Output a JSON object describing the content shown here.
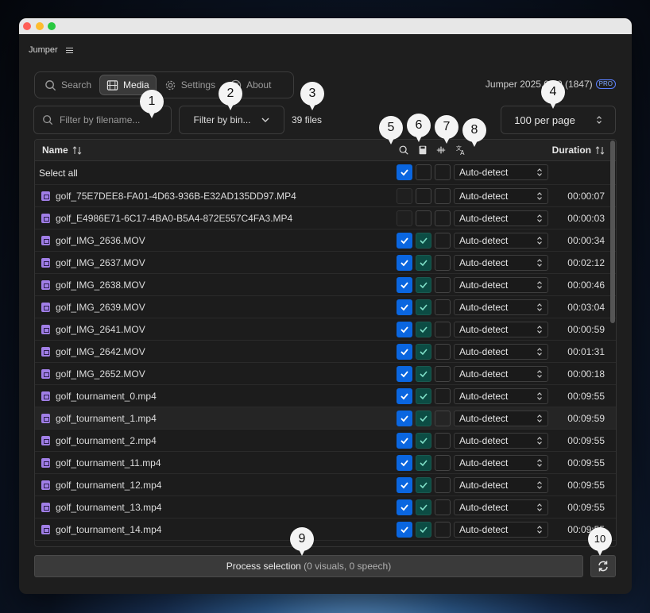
{
  "app": {
    "name": "Jumper",
    "version": "Jumper 2025.05.0 (1847)",
    "badge": "PRO"
  },
  "tabs": [
    {
      "label": "Search",
      "icon": "search-icon"
    },
    {
      "label": "Media",
      "icon": "film-icon",
      "active": true
    },
    {
      "label": "Settings",
      "icon": "gear-icon"
    },
    {
      "label": "About",
      "icon": "lifebuoy-icon"
    }
  ],
  "filters": {
    "filename_placeholder": "Filter by filename...",
    "bin_label": "Filter by bin...",
    "files_count": "39 files",
    "per_page": "100 per page"
  },
  "table": {
    "col_name": "Name",
    "col_duration": "Duration",
    "select_all": "Select all",
    "select_all_lang": "Auto-detect",
    "rows": [
      {
        "name": "golf_75E7DEE8-FA01-4D63-936B-E32AD135DD97.MP4",
        "lang": "Auto-detect",
        "duration": "00:00:07"
      },
      {
        "name": "golf_E4986E71-6C17-4BA0-B5A4-872E557C4FA3.MP4",
        "lang": "Auto-detect",
        "duration": "00:00:03"
      },
      {
        "name": "golf_IMG_2636.MOV",
        "lang": "Auto-detect",
        "duration": "00:00:34"
      },
      {
        "name": "golf_IMG_2637.MOV",
        "lang": "Auto-detect",
        "duration": "00:02:12"
      },
      {
        "name": "golf_IMG_2638.MOV",
        "lang": "Auto-detect",
        "duration": "00:00:46"
      },
      {
        "name": "golf_IMG_2639.MOV",
        "lang": "Auto-detect",
        "duration": "00:03:04"
      },
      {
        "name": "golf_IMG_2641.MOV",
        "lang": "Auto-detect",
        "duration": "00:00:59"
      },
      {
        "name": "golf_IMG_2642.MOV",
        "lang": "Auto-detect",
        "duration": "00:01:31"
      },
      {
        "name": "golf_IMG_2652.MOV",
        "lang": "Auto-detect",
        "duration": "00:00:18"
      },
      {
        "name": "golf_tournament_0.mp4",
        "lang": "Auto-detect",
        "duration": "00:09:55"
      },
      {
        "name": "golf_tournament_1.mp4",
        "lang": "Auto-detect",
        "duration": "00:09:59"
      },
      {
        "name": "golf_tournament_2.mp4",
        "lang": "Auto-detect",
        "duration": "00:09:55"
      },
      {
        "name": "golf_tournament_11.mp4",
        "lang": "Auto-detect",
        "duration": "00:09:55"
      },
      {
        "name": "golf_tournament_12.mp4",
        "lang": "Auto-detect",
        "duration": "00:09:55"
      },
      {
        "name": "golf_tournament_13.mp4",
        "lang": "Auto-detect",
        "duration": "00:09:55"
      },
      {
        "name": "golf_tournament_14.mp4",
        "lang": "Auto-detect",
        "duration": "00:09:55"
      }
    ]
  },
  "footer": {
    "process_label": "Process selection",
    "process_counts": "(0 visuals, 0 speech)"
  },
  "callouts": [
    "1",
    "2",
    "3",
    "4",
    "5",
    "6",
    "7",
    "8",
    "9",
    "10"
  ],
  "colors": {
    "accent_blue": "#0a66e0",
    "teal_check": "#0c4c44",
    "media_icon": "#a07ee6"
  }
}
